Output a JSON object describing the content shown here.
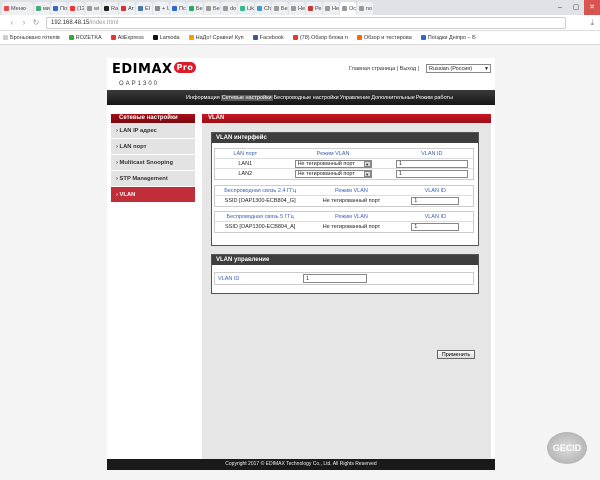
{
  "browser": {
    "tabs": [
      {
        "label": "Меню",
        "color": "#e44"
      },
      {
        "label": "ми",
        "color": "#4a7"
      },
      {
        "label": "По",
        "color": "#36c"
      },
      {
        "label": "(12",
        "color": "#e33"
      },
      {
        "label": "wi",
        "color": "#999"
      },
      {
        "label": "Ra",
        "color": "#222"
      },
      {
        "label": "Ат",
        "color": "#c33"
      },
      {
        "label": "El",
        "color": "#47a"
      },
      {
        "label": "+ UK",
        "color": "#888"
      },
      {
        "label": "Пс",
        "color": "#36c"
      },
      {
        "label": "Бе",
        "color": "#2a6"
      },
      {
        "label": "Бе",
        "color": "#999"
      },
      {
        "label": "do",
        "color": "#999"
      },
      {
        "label": "Lik",
        "color": "#3b8"
      },
      {
        "label": "Ch",
        "color": "#49c"
      },
      {
        "label": "Бе",
        "color": "#999"
      },
      {
        "label": "Не",
        "color": "#999"
      },
      {
        "label": "Ре",
        "color": "#c33"
      },
      {
        "label": "Не",
        "color": "#999"
      },
      {
        "label": "Ос",
        "color": "#999"
      },
      {
        "label": "no",
        "color": "#999"
      }
    ],
    "window_controls": {
      "minimize": "‒",
      "maximize": "▢",
      "close": "✕"
    },
    "url_host": "192.168.48.15",
    "url_path": "/index.html",
    "bookmarks": [
      {
        "label": "Броньовано готелів",
        "color": "#ccc"
      },
      {
        "label": "ROZETKA",
        "color": "#3a3"
      },
      {
        "label": "AliExpress",
        "color": "#e33"
      },
      {
        "label": "Lamoda",
        "color": "#111"
      },
      {
        "label": "НаДо! Сравни! Куп",
        "color": "#f90"
      },
      {
        "label": "Facebook",
        "color": "#3b5998"
      },
      {
        "label": "(78) Обзор блока п",
        "color": "#e33"
      },
      {
        "label": "Обзор и тестирова",
        "color": "#f60"
      },
      {
        "label": "Поїздки Дніпро – Б",
        "color": "#36c"
      }
    ]
  },
  "router": {
    "logo": "EDIMAX",
    "logo_badge": "Pro",
    "model": "OAP1300",
    "top_links": "Главная страница | Выход |",
    "language": "Russian (Россия)",
    "menu": [
      {
        "label": "Информация",
        "active": false
      },
      {
        "label": "Сетевые настройки",
        "active": true
      },
      {
        "label": "Беспроводные настройки",
        "active": false
      },
      {
        "label": "Управление",
        "active": false
      },
      {
        "label": "Дополнительные",
        "active": false
      },
      {
        "label": "Режим работы",
        "active": false
      }
    ],
    "sidebar": {
      "title": "Сетевые настройки",
      "items": [
        {
          "label": "LAN IP адрес",
          "active": false
        },
        {
          "label": "LAN порт",
          "active": false
        },
        {
          "label": "Multicast Snooping",
          "active": false
        },
        {
          "label": "STP Management",
          "active": false
        },
        {
          "label": "VLAN",
          "active": true
        }
      ]
    },
    "content": {
      "title": "VLAN",
      "vlan_interface": {
        "heading": "VLAN интерфейс",
        "lan": {
          "headers": [
            "LAN порт",
            "Режим VLAN",
            "VLAN ID"
          ],
          "rows": [
            {
              "port": "LAN1",
              "mode": "Не тегированный порт",
              "vlan_id": "1"
            },
            {
              "port": "LAN2",
              "mode": "Не тегированный порт",
              "vlan_id": "1"
            }
          ]
        },
        "wireless_24": {
          "headers": [
            "Беспроводная связь 2.4 ГГц",
            "Режим VLAN",
            "VLAN ID"
          ],
          "rows": [
            {
              "ssid": "SSID [OAP1300-ECB804_G]",
              "mode": "Не тегированный порт",
              "vlan_id": "1"
            }
          ]
        },
        "wireless_5": {
          "headers": [
            "Беспроводная связь 5 ГГц",
            "Режим VLAN",
            "VLAN ID"
          ],
          "rows": [
            {
              "ssid": "SSID [OAP1300-ECB804_A]",
              "mode": "Не тегированный порт",
              "vlan_id": "1"
            }
          ]
        }
      },
      "vlan_management": {
        "heading": "VLAN управление",
        "label": "VLAN ID",
        "value": "1"
      },
      "apply_label": "Применить"
    },
    "footer": "Copyright 2017 © EDIMAX Technology Co., Ltd. All Rights Reserved"
  },
  "watermark": "GECID"
}
